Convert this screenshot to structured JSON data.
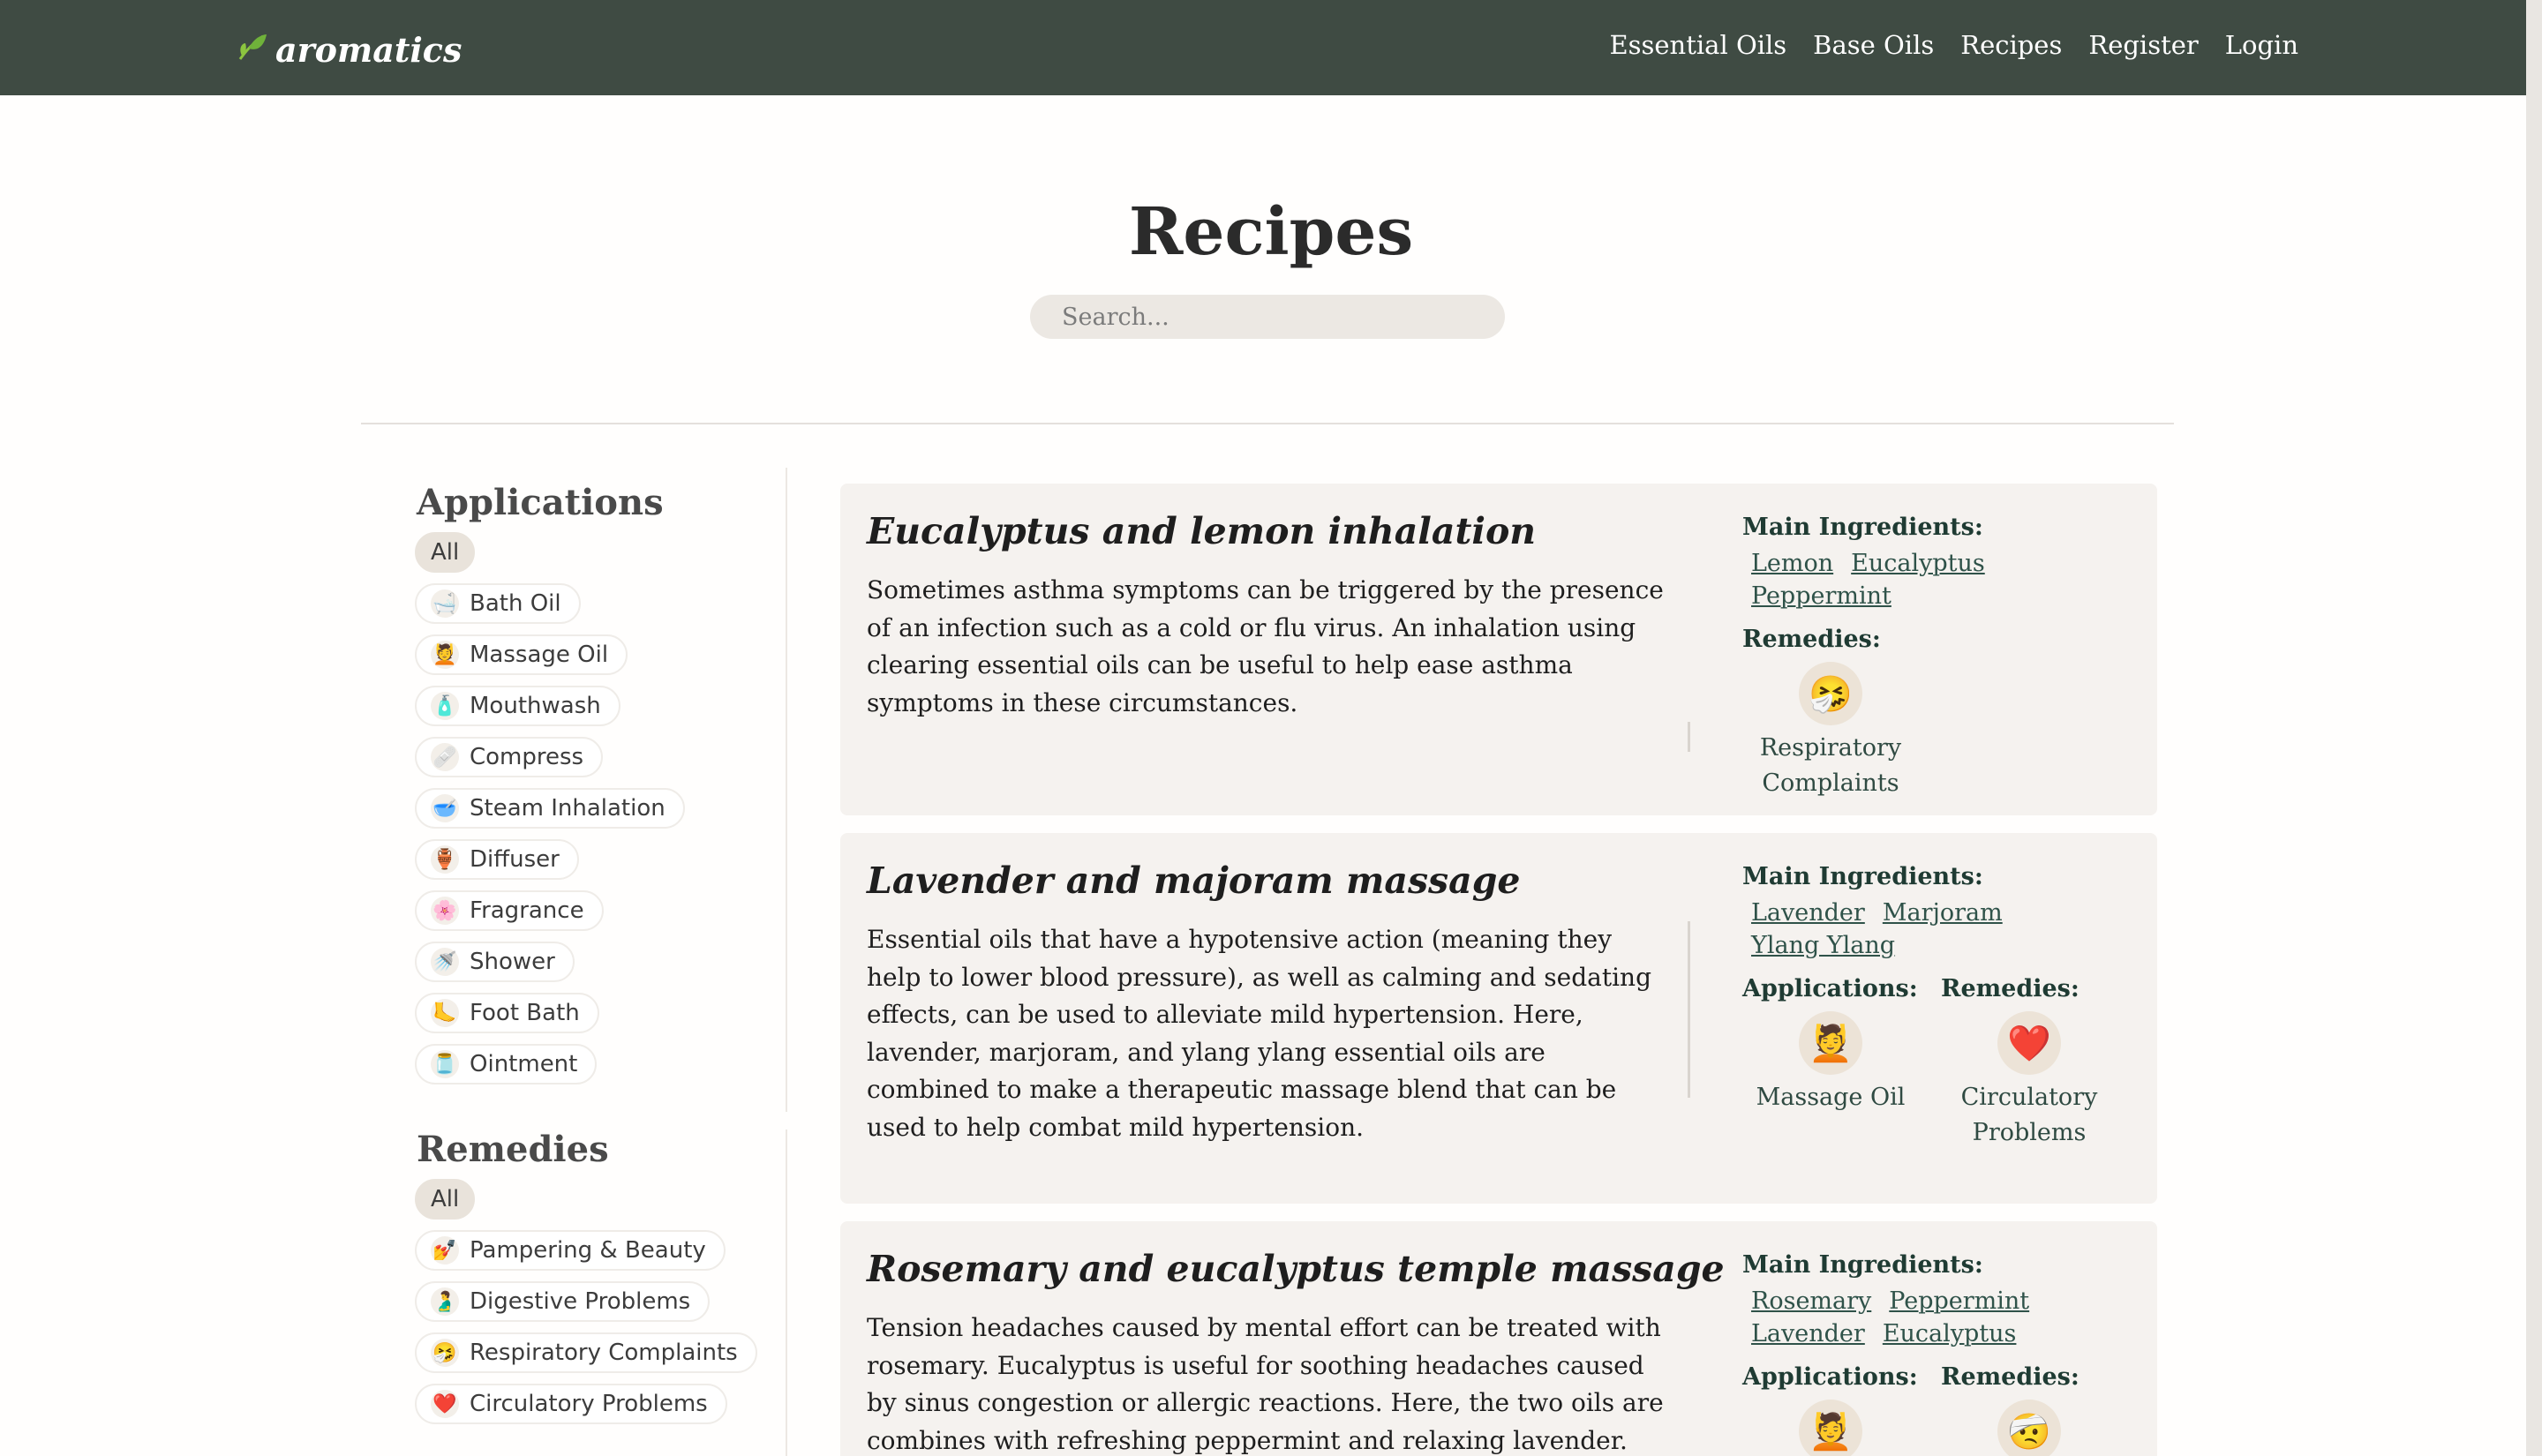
{
  "brand": {
    "name": "aromatics"
  },
  "nav": {
    "links": [
      "Essential Oils",
      "Base Oils",
      "Recipes",
      "Register",
      "Login"
    ]
  },
  "page": {
    "title": "Recipes",
    "search_placeholder": "Search..."
  },
  "sidebar": {
    "applications": {
      "title": "Applications",
      "all_label": "All",
      "items": [
        {
          "label": "Bath Oil",
          "icon": "bathtub-icon"
        },
        {
          "label": "Massage Oil",
          "icon": "massage-icon"
        },
        {
          "label": "Mouthwash",
          "icon": "mouthwash-icon"
        },
        {
          "label": "Compress",
          "icon": "compress-icon"
        },
        {
          "label": "Steam Inhalation",
          "icon": "steam-bowl-icon"
        },
        {
          "label": "Diffuser",
          "icon": "diffuser-icon"
        },
        {
          "label": "Fragrance",
          "icon": "perfume-icon"
        },
        {
          "label": "Shower",
          "icon": "shower-icon"
        },
        {
          "label": "Foot Bath",
          "icon": "foot-icon"
        },
        {
          "label": "Ointment",
          "icon": "ointment-icon"
        }
      ]
    },
    "remedies": {
      "title": "Remedies",
      "all_label": "All",
      "items": [
        {
          "label": "Pampering & Beauty",
          "icon": "beauty-icon"
        },
        {
          "label": "Digestive Problems",
          "icon": "stomach-icon"
        },
        {
          "label": "Respiratory Complaints",
          "icon": "respiratory-icon"
        },
        {
          "label": "Circulatory Problems",
          "icon": "heart-icon"
        }
      ]
    }
  },
  "labels": {
    "main_ingredients": "Main Ingredients:",
    "remedies": "Remedies:",
    "applications": "Applications:"
  },
  "recipes": [
    {
      "title": "Eucalyptus and lemon inhalation",
      "description": "Sometimes asthma symptoms can be triggered by the presence of an infection such as a cold or flu virus. An inhalation using clearing essential oils can be useful to help ease asthma symptoms in these circumstances.",
      "ingredients": [
        "Lemon",
        "Eucalyptus",
        "Peppermint"
      ],
      "remedies": [
        {
          "label": "Respiratory Complaints",
          "icon": "respiratory-icon"
        }
      ]
    },
    {
      "title": "Lavender and majoram massage",
      "description": "Essential oils that have a hypotensive action (meaning they help to lower blood pressure), as well as calming and sedating effects, can be used to alleviate mild hypertension. Here, lavender, marjoram, and ylang ylang essential oils are combined to make a therapeutic massage blend that can be used to help combat mild hypertension.",
      "ingredients": [
        "Lavender",
        "Marjoram",
        "Ylang Ylang"
      ],
      "applications": [
        {
          "label": "Massage Oil",
          "icon": "massage-icon"
        }
      ],
      "remedies": [
        {
          "label": "Circulatory Problems",
          "icon": "heart-icon"
        }
      ]
    },
    {
      "title": "Rosemary and eucalyptus temple massage",
      "description": "Tension headaches caused by mental effort can be treated with rosemary. Eucalyptus is useful for soothing headaches caused by sinus congestion or allergic reactions. Here, the two oils are combines with refreshing peppermint and relaxing lavender.",
      "ingredients": [
        "Rosemary",
        "Peppermint",
        "Lavender",
        "Eucalyptus"
      ]
    }
  ]
}
